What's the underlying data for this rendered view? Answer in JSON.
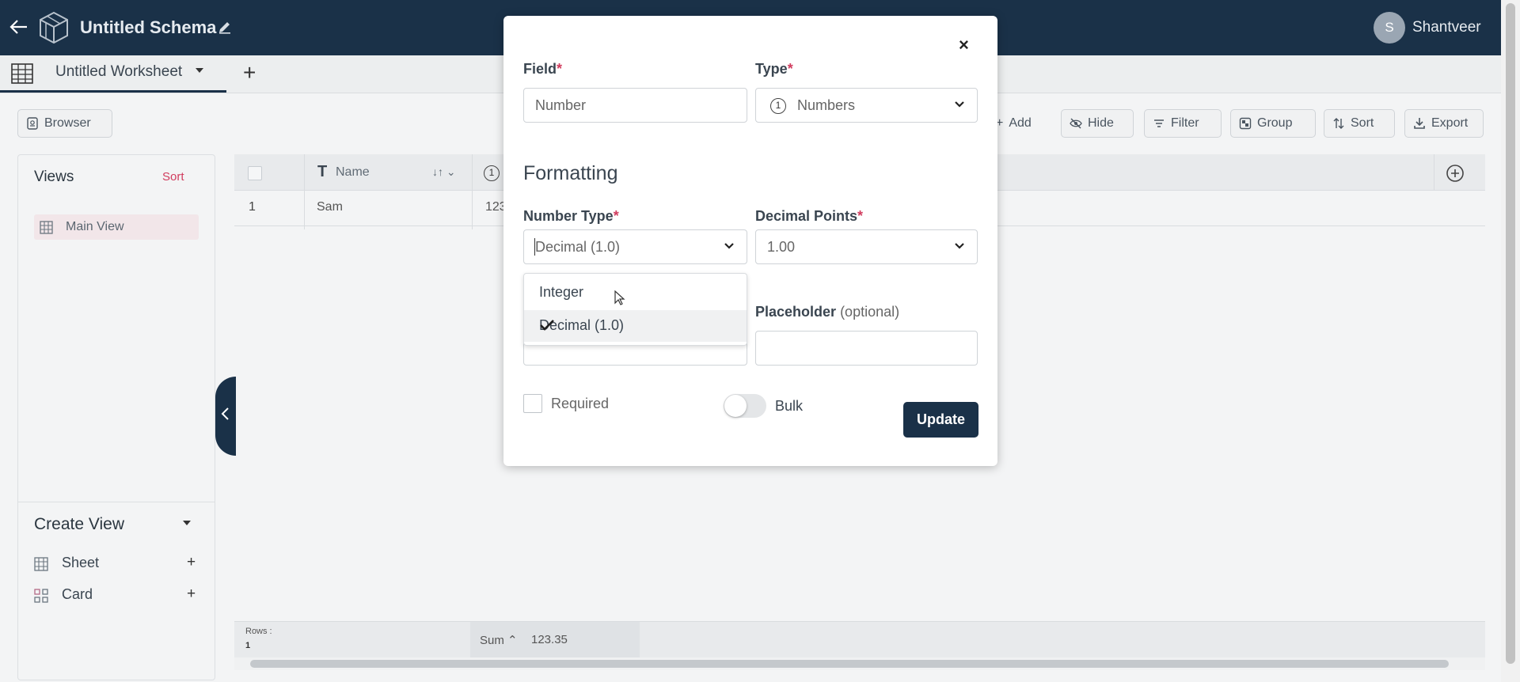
{
  "topbar": {
    "title": "Untitled Schema",
    "avatar_initial": "S",
    "username": "Shantveer"
  },
  "tabbar": {
    "tab_label": "Untitled Worksheet",
    "add_tab": "+"
  },
  "toolbar": {
    "browser": "Browser",
    "add": "Add",
    "hide": "Hide",
    "filter": "Filter",
    "group": "Group",
    "sort": "Sort",
    "export": "Export"
  },
  "sidebar": {
    "views_title": "Views",
    "views_sort": "Sort",
    "main_view": "Main View",
    "create_view_title": "Create View",
    "create_items": [
      {
        "label": "Sheet",
        "plus": "+"
      },
      {
        "label": "Card",
        "plus": "+"
      }
    ]
  },
  "grid": {
    "columns": {
      "name": "Name",
      "name_glyph": "T",
      "number_glyph": "1"
    },
    "rows": [
      {
        "index": "1",
        "name": "Sam",
        "number": "123"
      }
    ],
    "footer": {
      "rows_label": "Rows :",
      "rows_value": "1",
      "sum_label": "Sum",
      "sum_value": "123.35"
    }
  },
  "modal": {
    "close": "×",
    "field_label": "Field",
    "field_value": "Number",
    "type_label": "Type",
    "type_value": "Numbers",
    "formatting": "Formatting",
    "number_type_label": "Number Type",
    "number_type_value": "Decimal (1.0)",
    "decimal_points_label": "Decimal Points",
    "decimal_points_value": "1.00",
    "dropdown_options": [
      {
        "label": "Integer",
        "selected": false
      },
      {
        "label": "Decimal (1.0)",
        "selected": true
      }
    ],
    "placeholder_label": "Placeholder",
    "placeholder_optional": "(optional)",
    "placeholder_value": "",
    "required_label": "Required",
    "required_checked": false,
    "bulk_label": "Bulk",
    "bulk_on": false,
    "update_label": "Update",
    "required_marker": "*"
  },
  "colors": {
    "navy": "#1a3148",
    "accent_red": "#d13c5e"
  },
  "icons": [
    "back-arrow-icon",
    "cube-logo-icon",
    "pencil-icon",
    "table-grid-icon",
    "chevron-down-icon",
    "plus-icon",
    "browser-icon",
    "eye-off-icon",
    "filter-icon",
    "group-icon",
    "sort-icon",
    "download-icon",
    "add-circle-icon",
    "close-icon",
    "check-icon",
    "chevron-left-icon",
    "number-circle-icon"
  ]
}
